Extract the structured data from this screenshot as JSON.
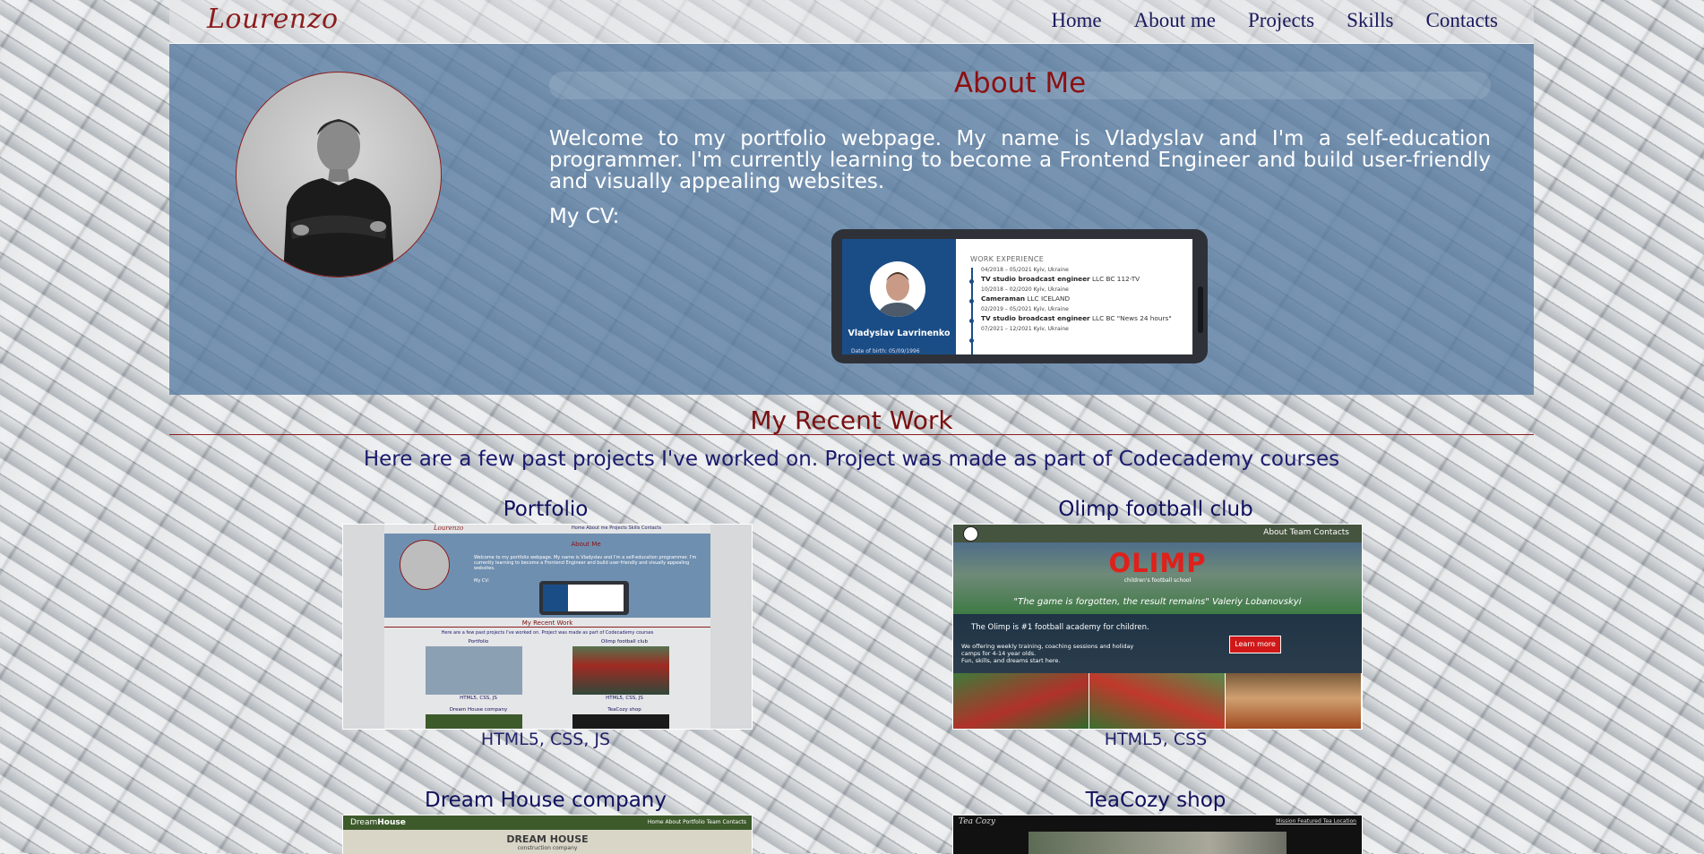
{
  "header": {
    "logo": "Lourenzo",
    "nav": [
      "Home",
      "About me",
      "Projects",
      "Skills",
      "Contacts"
    ]
  },
  "about": {
    "title": "About Me",
    "text": "Welcome to my portfolio webpage. My name is Vladyslav and I'm a self-education programmer. I'm currently learning to become a Frontend Engineer and build user-friendly and visually appealing websites.",
    "cv_label": "My CV:",
    "cv_preview": {
      "name": "Vladyslav Lavrinenko",
      "dob": "Date of birth: 05/09/1996",
      "section": "WORK EXPERIENCE",
      "entries": [
        {
          "date": "04/2018 – 05/2021 Kyiv, Ukraine",
          "position": "TV studio broadcast engineer",
          "company": "LLC BC 112-TV"
        },
        {
          "date": "10/2018 – 02/2020 Kyiv, Ukraine",
          "position": "Cameraman",
          "company": "LLC ICELAND"
        },
        {
          "date": "02/2019 – 05/2021 Kyiv, Ukraine",
          "position": "TV studio broadcast engineer",
          "company": "LLC BC \"News 24 hours\""
        },
        {
          "date": "07/2021 – 12/2021 Kyiv, Ukraine",
          "position": "",
          "company": ""
        }
      ]
    }
  },
  "work": {
    "title": "My Recent Work",
    "subtitle": "Here are a few past projects I've worked on. Project was made as part of Codecademy courses",
    "projects": [
      {
        "title": "Portfolio",
        "tech": "HTML5, CSS, JS"
      },
      {
        "title": "Olimp football club",
        "tech": "HTML5, CSS"
      },
      {
        "title": "Dream House company",
        "tech": ""
      },
      {
        "title": "TeaCozy shop",
        "tech": ""
      }
    ]
  },
  "thumb_portfolio": {
    "logo": "Lourenzo",
    "links": "Home   About me   Projects   Skills   Contacts",
    "title": "About Me",
    "text": "Welcome to my portfolio webpage. My name is Vladyslav and I'm a self-education programmer. I'm currently learning to become a Frontend Engineer and build user-friendly and visually appealing websites.",
    "cv": "My CV:",
    "work_title": "My Recent Work",
    "work_sub": "Here are a few past projects I've worked on. Project was made as part of Codecademy courses",
    "p1": "Portfolio",
    "p1_tech": "HTML5, CSS, JS",
    "p2": "Olimp football club",
    "p2_tech": "HTML5, CSS",
    "p3": "Dream House company",
    "p4": "TeaCozy shop"
  },
  "thumb_olimp": {
    "links": "About   Team   Contacts",
    "logo": "OLIMP",
    "sub": "children's football school",
    "quote": "\"The game is forgotten, the result remains\" Valeriy Lobanovskyi",
    "line1": "The Olimp is #1 football academy for children.",
    "line2": "We offering weekly training, coaching sessions and holiday",
    "line3": "camps for 4-14 year olds.",
    "line4": "Fun, skills, and dreams start here.",
    "button": "Learn more"
  },
  "thumb_dream": {
    "logo_a": "Dream",
    "logo_b": "House",
    "links": "Home  About  Portfolio  Team  Contacts",
    "heading": "DREAM HOUSE",
    "sub": "construction company"
  },
  "thumb_tea": {
    "logo": "Tea Cozy",
    "links": "Mission   Featured Tea   Location"
  },
  "colors": {
    "accent_red": "#8c1d1d",
    "nav_blue": "#1a1a5e",
    "about_bg": "#567aa0",
    "cv_blue": "#1a4d86"
  }
}
